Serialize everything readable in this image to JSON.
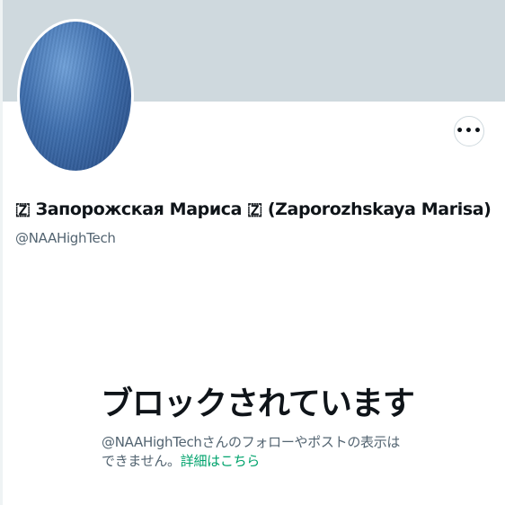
{
  "profile": {
    "display_name": "🇿 Запорожская Мариса 🇿 (Zaporozhskaya Marisa)",
    "handle": "@NAAHighTech"
  },
  "actions": {
    "more_glyph": "•••"
  },
  "blocked": {
    "title": "ブロックされています",
    "description": "@NAAHighTechさんのフォローやポストの表示はできません。",
    "link_text": "詳細はこちら"
  },
  "colors": {
    "banner": "#cfd9de",
    "text_primary": "#0f1419",
    "text_secondary": "#536471",
    "link": "#00a36c"
  },
  "icons": {
    "more": "more-horizontal-icon"
  }
}
